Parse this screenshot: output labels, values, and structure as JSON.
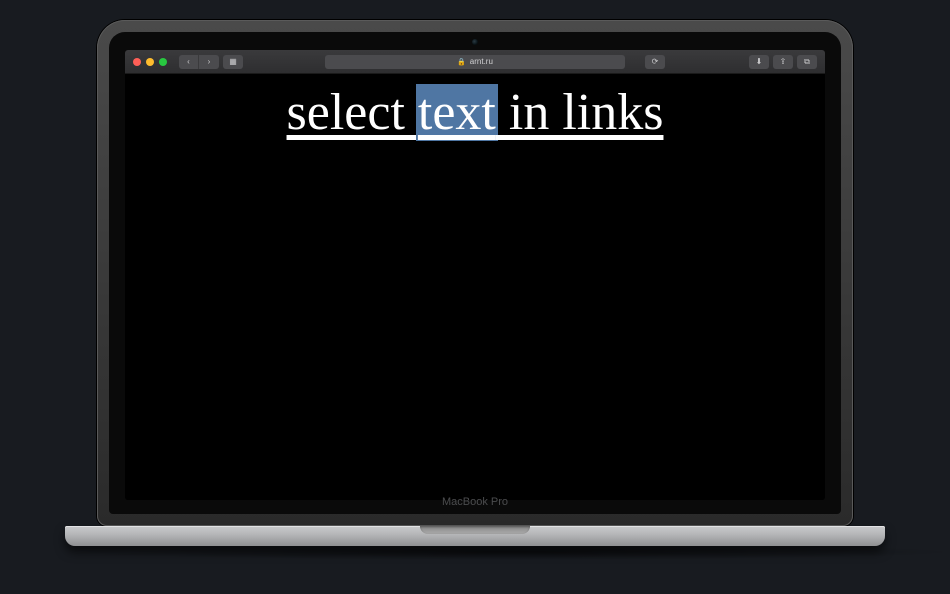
{
  "browser": {
    "url_host": "arnt.ru",
    "address_lock": "🔒",
    "back": "‹",
    "forward": "›",
    "sidebar": "▦",
    "reload": "⟳",
    "downloads": "⬇",
    "share": "⇪",
    "tabs": "⧉"
  },
  "page": {
    "headline_part1": "select ",
    "headline_selected": "text",
    "headline_part2": " in links"
  },
  "device": {
    "brand": "MacBook Pro"
  },
  "colors": {
    "selection": "#4f76a3"
  }
}
